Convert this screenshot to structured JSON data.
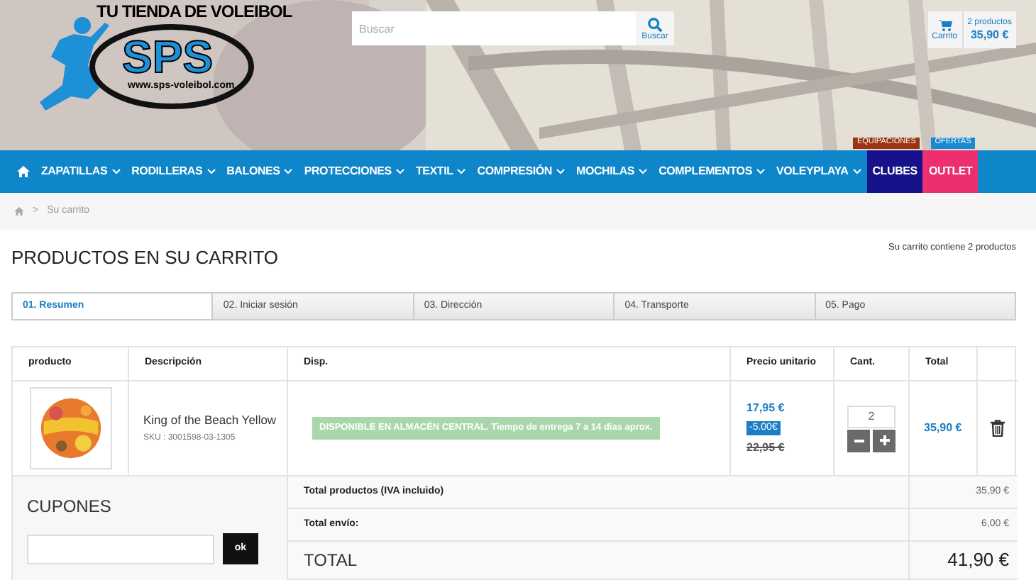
{
  "logo": {
    "tagline": "TU TIENDA DE VOLEIBOL",
    "name": "SPS",
    "url": "www.sps-voleibol.com"
  },
  "search": {
    "placeholder": "Buscar",
    "button": "Buscar"
  },
  "cart_summary": {
    "label": "Carrito",
    "count": "2 productos",
    "amount": "35,90 €"
  },
  "nav": [
    {
      "label": "ZAPATILLAS",
      "dropdown": true
    },
    {
      "label": "RODILLERAS",
      "dropdown": true
    },
    {
      "label": "BALONES",
      "dropdown": true
    },
    {
      "label": "PROTECCIONES",
      "dropdown": true
    },
    {
      "label": "TEXTIL",
      "dropdown": true
    },
    {
      "label": "COMPRESIÓN",
      "dropdown": true
    },
    {
      "label": "MOCHILAS",
      "dropdown": true
    },
    {
      "label": "COMPLEMENTOS",
      "dropdown": true
    },
    {
      "label": "VOLEYPLAYA",
      "dropdown": true
    },
    {
      "label": "CLUBES",
      "dropdown": false,
      "color": "#16128a",
      "badge": {
        "label": "EQUIPACIONES",
        "color": "#9a3412"
      }
    },
    {
      "label": "OUTLET",
      "dropdown": false,
      "color": "#ee2f6f",
      "badge": {
        "label": "OFERTAS",
        "color": "#1a8ad0"
      }
    }
  ],
  "breadcrumb": {
    "separator": ">",
    "items": [
      "Su carrito"
    ]
  },
  "page_title": "PRODUCTOS EN SU CARRITO",
  "cart_count_note": "Su carrito contiene 2 productos",
  "steps": [
    {
      "label": "01. Resumen",
      "selected": true
    },
    {
      "label": "02. Iniciar sesión",
      "selected": false
    },
    {
      "label": "03. Dirección",
      "selected": false
    },
    {
      "label": "04. Transporte",
      "selected": false
    },
    {
      "label": "05. Pago",
      "selected": false
    }
  ],
  "table": {
    "columns": [
      "producto",
      "Descripción",
      "Disp.",
      "Precio unitario",
      "Cant.",
      "Total"
    ],
    "rows": [
      {
        "name": "King of the Beach Yellow",
        "sku": "SKU : 3001598-03-1305",
        "availability_status": "DISPONIBLE EN ALMACÉN CENTRAL.",
        "availability_note": "Tiempo de entrega 7 a 14 días aprox.",
        "price": "17,95 €",
        "discount": "-5.00€",
        "old_price": "22,95 €",
        "quantity": "2",
        "total": "35,90 €"
      }
    ]
  },
  "coupons": {
    "title": "CUPONES",
    "button": "ok"
  },
  "totals": [
    {
      "label": "Total productos (IVA incluido)",
      "value": "35,90 €",
      "kind": "subtotal"
    },
    {
      "label": "Total envío:",
      "value": "6,00 €",
      "kind": "subtotal"
    },
    {
      "label": "TOTAL",
      "value": "41,90 €",
      "kind": "grand"
    }
  ]
}
